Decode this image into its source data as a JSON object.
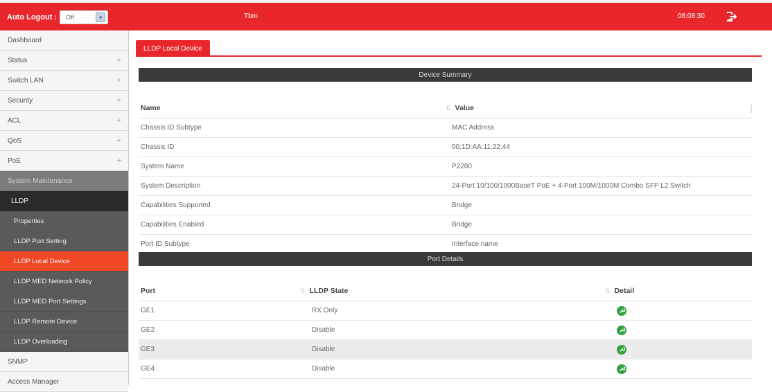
{
  "topbar": {
    "auto_logout_label": "Auto Logout :",
    "auto_logout_value": "Off",
    "center_text": "Tbm",
    "clock": "08:08:30",
    "logout_icon": "logout-icon",
    "bg_color": "#e8262b"
  },
  "sidebar": {
    "items": [
      {
        "label": "Dashboard",
        "expand": ""
      },
      {
        "label": "Status",
        "expand": "+"
      },
      {
        "label": "Switch LAN",
        "expand": "+"
      },
      {
        "label": "Security",
        "expand": "+"
      },
      {
        "label": "ACL",
        "expand": "+"
      },
      {
        "label": "QoS",
        "expand": "+"
      },
      {
        "label": "PoE",
        "expand": "+"
      }
    ],
    "group_label": "System Maintenance",
    "group_expand": "-",
    "lldp_label": "LLDP",
    "sub_items": [
      {
        "label": "Properties"
      },
      {
        "label": "LLDP Port Setting"
      },
      {
        "label": "LLDP Local Device",
        "active": true
      },
      {
        "label": "LLDP MED Network Policy"
      },
      {
        "label": "LLDP MED Port Settings"
      },
      {
        "label": "LLDP Remote Device"
      },
      {
        "label": "LLDP Overloading"
      }
    ],
    "after_items": [
      {
        "label": "SNMP"
      },
      {
        "label": "Access Manager"
      }
    ],
    "active_color": "#f04724"
  },
  "main": {
    "tab_label": "LLDP Local Device",
    "device_summary": {
      "title": "Device Summary",
      "headers": {
        "name": "Name",
        "value": "Value"
      },
      "rows": [
        {
          "name": "Chassis ID Subtype",
          "value": "MAC Address"
        },
        {
          "name": "Chassis ID",
          "value": "00:1D:AA:11:22:44"
        },
        {
          "name": "System Name",
          "value": "P2280"
        },
        {
          "name": "System Description",
          "value": "24-Port 10/100/1000BaseT PoE + 4-Port 100M/1000M Combo SFP L2 Switch"
        },
        {
          "name": "Capabilities Supported",
          "value": "Bridge"
        },
        {
          "name": "Capabilities Enabled",
          "value": "Bridge"
        },
        {
          "name": "Port ID Subtype",
          "value": "Interface name"
        }
      ]
    },
    "port_details": {
      "title": "Port Details",
      "headers": {
        "port": "Port",
        "state": "LLDP State",
        "detail": "Detail"
      },
      "rows": [
        {
          "port": "GE1",
          "state": "RX Only"
        },
        {
          "port": "GE2",
          "state": "Disable"
        },
        {
          "port": "GE3",
          "state": "Disable"
        },
        {
          "port": "GE4",
          "state": "Disable"
        }
      ],
      "detail_icon": "wrench-icon",
      "detail_color": "#35a23d"
    }
  }
}
